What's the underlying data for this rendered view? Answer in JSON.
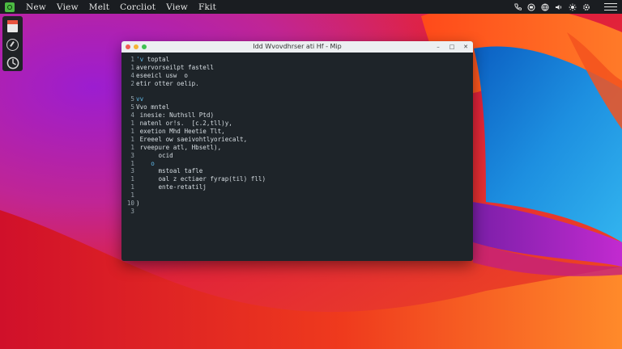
{
  "menubar": {
    "menus": [
      "New",
      "View",
      "Melt",
      "Corcliot",
      "View",
      "Fkit"
    ],
    "tray_icons": [
      "phone-icon",
      "display-icon",
      "globe-icon",
      "volume-icon",
      "brightness-icon",
      "settings-icon"
    ]
  },
  "dock": {
    "items": [
      {
        "name": "file-icon",
        "label": "pdf"
      },
      {
        "name": "browser-icon"
      },
      {
        "name": "compass-icon"
      }
    ]
  },
  "editor": {
    "title": "Idd Wvovdhrser ati Hf - Mip",
    "line_numbers": [
      "1",
      "1",
      "4",
      "2",
      "",
      "5",
      "5",
      "4",
      "1",
      "1",
      "1",
      "1",
      "3",
      "1",
      "3",
      "1",
      "1",
      "1",
      "10",
      "3"
    ],
    "lines": [
      {
        "indent": "",
        "prefix": "'v ",
        "text": "toptal"
      },
      {
        "indent": "",
        "prefix": "",
        "text": "avervorseilpt fastell"
      },
      {
        "indent": "",
        "prefix": "",
        "text": "eseeicl usw  o"
      },
      {
        "indent": "",
        "prefix": "",
        "text": "etir otter oelip."
      },
      {
        "indent": "",
        "prefix": "",
        "text": ""
      },
      {
        "indent": "",
        "prefix": "",
        "text": "vv"
      },
      {
        "indent": "",
        "prefix": "",
        "text": "Vvo mntel"
      },
      {
        "indent": " ",
        "prefix": "",
        "text": "inesie: Nuthsll Ptd)"
      },
      {
        "indent": " ",
        "prefix": "",
        "text": "natenl or!s.  [c.2,tll)y,"
      },
      {
        "indent": " ",
        "prefix": "",
        "text": "exetion Mhd Heetie Tlt,"
      },
      {
        "indent": " ",
        "prefix": "",
        "text": "Ereeel ow saeivohtlyoriecalt,"
      },
      {
        "indent": " ",
        "prefix": "",
        "text": "rveepure atl, Hbsetl),"
      },
      {
        "indent": "      ",
        "prefix": "",
        "text": "ocid"
      },
      {
        "indent": "    ",
        "prefix": "",
        "text": "o"
      },
      {
        "indent": "      ",
        "prefix": "",
        "text": "mstoal tafle"
      },
      {
        "indent": "      ",
        "prefix": "",
        "text": "oal z ectiaer fyrap(til) fll)"
      },
      {
        "indent": "      ",
        "prefix": "",
        "text": "ente-retatilj"
      },
      {
        "indent": "",
        "prefix": "",
        "text": ""
      },
      {
        "indent": "",
        "prefix": "",
        "text": ")"
      },
      {
        "indent": "",
        "prefix": "",
        "text": ""
      }
    ]
  },
  "colors": {
    "menubar_bg": "#1a1d21",
    "editor_bg": "#1e2429",
    "keyword": "#5fb7e6",
    "wallpaper_magenta": "#b11fbf",
    "wallpaper_orange": "#f26a1f",
    "wallpaper_blue": "#1f88d8"
  }
}
